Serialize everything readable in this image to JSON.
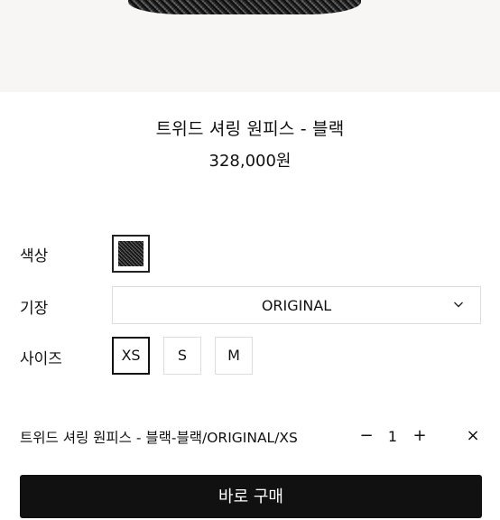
{
  "product": {
    "title": "트위드 셔링 원피스 - 블랙",
    "price": "328,000원"
  },
  "options": {
    "color": {
      "label": "색상"
    },
    "length": {
      "label": "기장",
      "selected": "ORIGINAL",
      "icon": "chevron-down-icon"
    },
    "size": {
      "label": "사이즈",
      "choices": [
        "XS",
        "S",
        "M"
      ],
      "selected": "XS"
    }
  },
  "selection": {
    "name": "트위드 셔링 원피스 - 블랙-블랙/ORIGINAL/XS",
    "quantity": "1",
    "minus": "−",
    "plus": "+",
    "remove": "×"
  },
  "buy_button": {
    "label": "바로 구매"
  },
  "colors": {
    "button_bg": "#111111",
    "border": "#dddddd",
    "image_bg": "#f8f6f5"
  }
}
